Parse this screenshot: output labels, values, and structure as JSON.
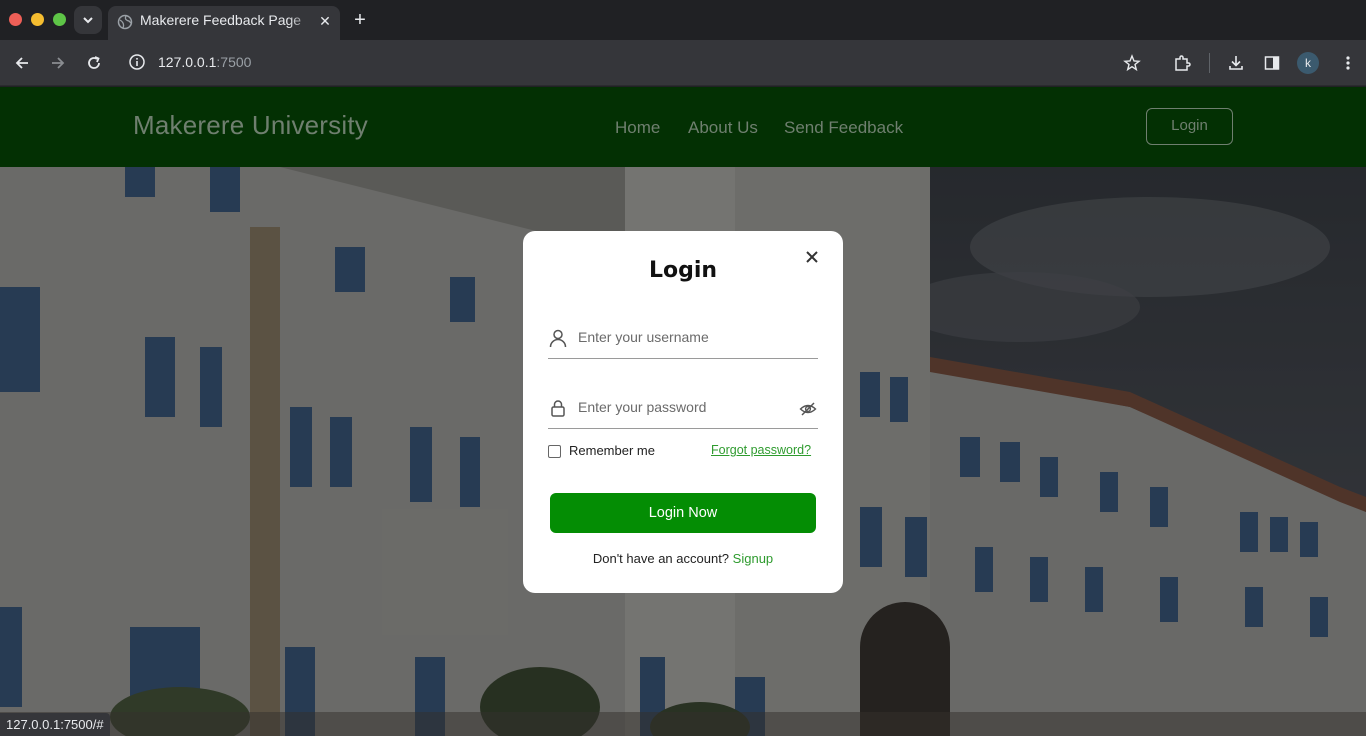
{
  "browser": {
    "tab_title": "Makerere Feedback Page",
    "url_host": "127.0.0.1",
    "url_port": ":7500",
    "profile_initial": "k",
    "status_url": "127.0.0.1:7500/#"
  },
  "site": {
    "brand": "Makerere University",
    "nav": {
      "home": "Home",
      "about": "About Us",
      "feedback": "Send Feedback",
      "login": "Login"
    }
  },
  "login_modal": {
    "title": "Login",
    "username_placeholder": "Enter your username",
    "password_placeholder": "Enter your password",
    "remember_label": "Remember me",
    "forgot_link": "Forgot password?",
    "submit_label": "Login Now",
    "signup_prompt": "Don't have an account?",
    "signup_link": "Signup"
  },
  "colors": {
    "navbar_bg": "#033003",
    "primary_button": "#048d04",
    "link_green": "#2e9b2e"
  }
}
